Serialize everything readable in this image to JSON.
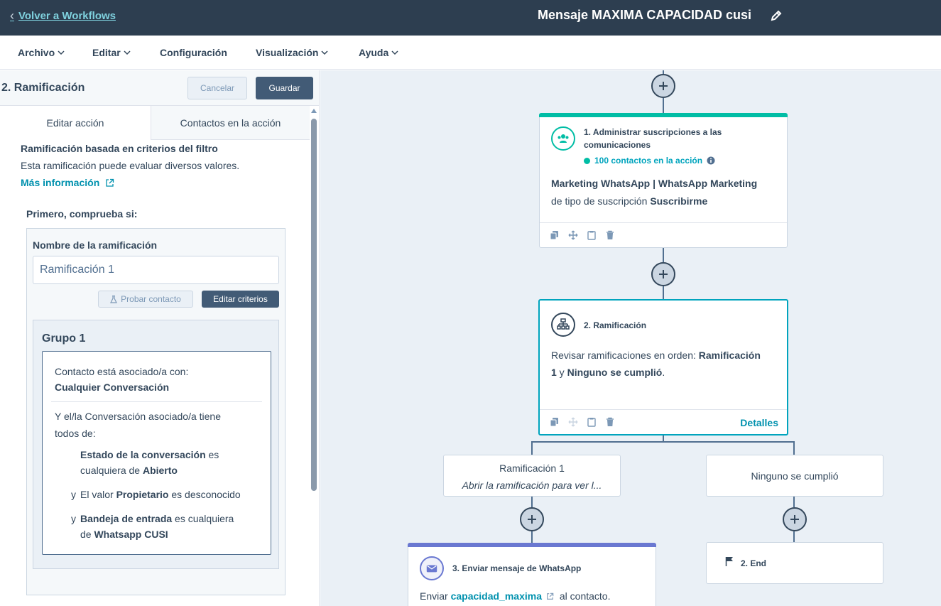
{
  "header": {
    "back_label": "Volver a Workflows",
    "workflow_title": "Mensaje MAXIMA CAPACIDAD cusi"
  },
  "menu": {
    "items": [
      {
        "label": "Archivo",
        "dropdown": true
      },
      {
        "label": "Editar",
        "dropdown": true
      },
      {
        "label": "Configuración",
        "dropdown": false
      },
      {
        "label": "Visualización",
        "dropdown": true
      },
      {
        "label": "Ayuda",
        "dropdown": true
      }
    ]
  },
  "panel": {
    "title": "2. Ramificación",
    "cancel_label": "Cancelar",
    "save_label": "Guardar",
    "tabs": [
      {
        "label": "Editar acción",
        "active": true
      },
      {
        "label": "Contactos en la acción",
        "active": false
      }
    ],
    "description_title": "Ramificación basada en criterios del filtro",
    "description_text": "Esta ramificación puede evaluar diversos valores.",
    "more_info_label": "Más información",
    "first_check_label": "Primero, comprueba si:",
    "branch_name_label": "Nombre de la ramificación",
    "branch_name_value": "Ramificación 1",
    "test_contact_label": "Probar contacto",
    "edit_criteria_label": "Editar criterios",
    "group": {
      "title": "Grupo 1",
      "line1": "Contacto está asociado/a con:",
      "line2": "Cualquier Conversación",
      "line3": "Y el/la Conversación asociado/a tiene",
      "line4": "todos de:",
      "f1_prop": "Estado de la conversación",
      "f1_op": " es",
      "f1_op2": "cualquiera de ",
      "f1_val": "Abierto",
      "f2_and": "y",
      "f2_pre": "El valor ",
      "f2_prop": "Propietario",
      "f2_op": " es desconocido",
      "f3_and": "y",
      "f3_prop": "Bandeja de entrada",
      "f3_op": " es cualquiera",
      "f3_op2": "de ",
      "f3_val": "Whatsapp CUSI"
    }
  },
  "canvas": {
    "action1": {
      "title_line1": "1. Administrar suscripciones a las",
      "title_line2": "comunicaciones",
      "contacts": "100 contactos en la acción",
      "body_line1": "Marketing WhatsApp | WhatsApp Marketing",
      "body_pre": "de tipo de suscripción ",
      "body_val": "Suscribirme",
      "accent": "#00bda5"
    },
    "action2": {
      "title": "2. Ramificación",
      "body_pre": "Revisar ramificaciones en orden: ",
      "body_b1a": "Ramificación",
      "body_b1b": "1",
      "body_mid": " y ",
      "body_b2": "Ninguno se cumplió",
      "body_end": ".",
      "details_label": "Detalles",
      "accent": "#00a4bd"
    },
    "branch1": {
      "title": "Ramificación 1",
      "subtitle": "Abrir la ramificación para ver l..."
    },
    "branch2": {
      "title": "Ninguno se cumplió"
    },
    "action3": {
      "title": "3. Enviar mensaje de WhatsApp",
      "body_pre": "Enviar ",
      "body_link": "capacidad_maxima",
      "body_post": " al contacto.",
      "accent": "#6a78d1"
    },
    "end": {
      "title": "2. End"
    }
  }
}
